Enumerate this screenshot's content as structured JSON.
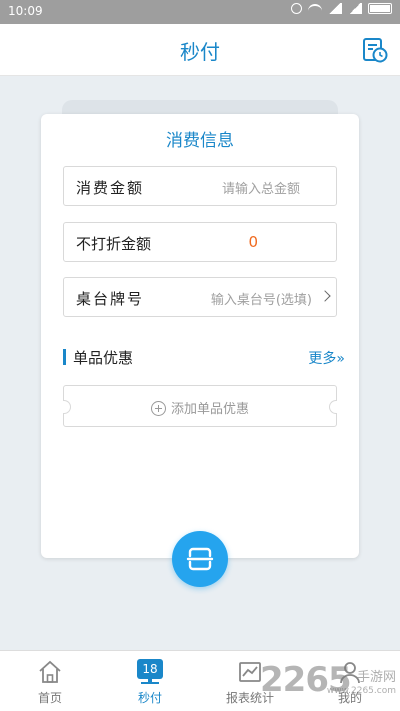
{
  "status_bar": {
    "time": "10:09"
  },
  "header": {
    "title": "秒付",
    "history_icon": "history-icon"
  },
  "card": {
    "title": "消费信息",
    "fields": [
      {
        "label": "消费金额",
        "placeholder": "请输入总金额"
      },
      {
        "label": "不打折金额",
        "value": "0"
      },
      {
        "label": "桌台牌号",
        "placeholder": "输入桌台号(选填)"
      }
    ],
    "section": {
      "title": "单品优惠",
      "more": "更多»"
    },
    "coupon": {
      "add_label": "添加单品优惠"
    }
  },
  "tabbar": {
    "items": [
      {
        "label": "首页",
        "icon": "home-icon",
        "active": false
      },
      {
        "label": "秒付",
        "icon": "calendar-badge-icon",
        "badge": "18",
        "active": true
      },
      {
        "label": "报表统计",
        "icon": "report-icon",
        "active": false
      },
      {
        "label": "我的",
        "icon": "user-icon",
        "active": false
      }
    ]
  },
  "watermark": {
    "main": "2265",
    "sub": "手游网",
    "url": "www.2265.com"
  },
  "colors": {
    "accent": "#1a87c9",
    "scan": "#25a4ee",
    "value_orange": "#f06a1f"
  }
}
